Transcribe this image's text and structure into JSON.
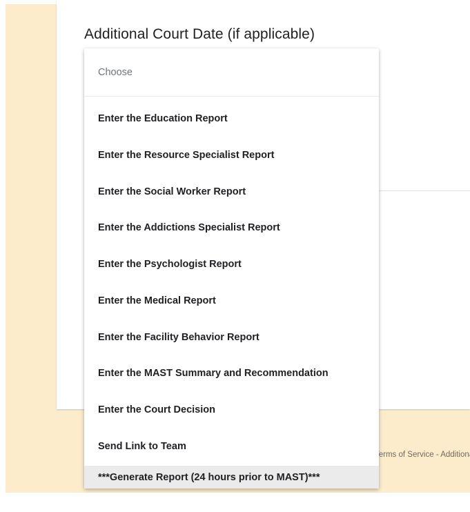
{
  "question": {
    "title": "Additional Court Date (if applicable)"
  },
  "footer": {
    "text": "Terms of Service - Additional Terms"
  },
  "dropdown": {
    "placeholder": "Choose",
    "options": [
      "Enter the Education Report",
      "Enter the Resource Specialist Report",
      "Enter the Social Worker Report",
      "Enter the Addictions Specialist Report",
      "Enter the Psychologist Report",
      "Enter the Medical Report",
      "Enter the Facility Behavior Report",
      "Enter the MAST Summary and Recommendation",
      "Enter the Court Decision",
      "Send Link to Team",
      "***Generate Report (24 hours prior to MAST)***"
    ],
    "highlighted_option": "***Generate Report (24 hours prior to MAST)***"
  },
  "colors": {
    "page_background": "#fdeccc",
    "card_background": "#ffffff",
    "highlight_background": "#ebebeb",
    "text_primary": "#202124",
    "text_placeholder": "#70757a"
  }
}
